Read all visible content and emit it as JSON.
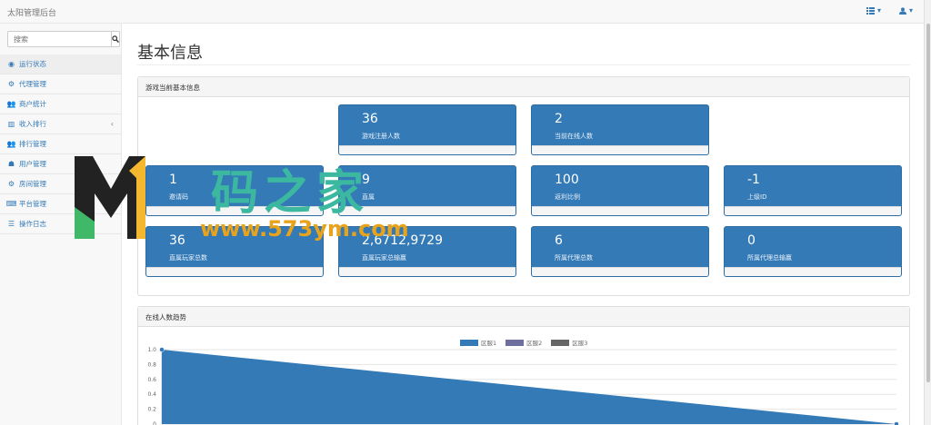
{
  "navbar": {
    "brand": "太阳管理后台",
    "menu_icon_caret": "▾",
    "user_icon_caret": "▾"
  },
  "sidebar": {
    "search_placeholder": "搜索",
    "items": [
      {
        "label": "运行状态",
        "icon": "dashboard-icon",
        "glyph": "◉",
        "active": true
      },
      {
        "label": "代理管理",
        "icon": "gear-icon",
        "glyph": "⚙"
      },
      {
        "label": "商户统计",
        "icon": "users-icon",
        "glyph": "👥"
      },
      {
        "label": "收入排行",
        "icon": "bar-chart-icon",
        "glyph": "▥",
        "caret": "‹"
      },
      {
        "label": "排行管理",
        "icon": "users-icon",
        "glyph": "👥"
      },
      {
        "label": "用户管理",
        "icon": "user-icon",
        "glyph": "☗"
      },
      {
        "label": "房间管理",
        "icon": "gear-icon",
        "glyph": "⚙"
      },
      {
        "label": "平台管理",
        "icon": "keyboard-icon",
        "glyph": "⌨"
      },
      {
        "label": "操作日志",
        "icon": "list-icon",
        "glyph": "☰"
      }
    ]
  },
  "main": {
    "page_title": "基本信息",
    "info_panel_title": "游戏当前基本信息",
    "stats": [
      {
        "value": "36",
        "label": "游戏注册人数"
      },
      {
        "value": "2",
        "label": "当前在线人数"
      },
      {
        "value": "1",
        "label": "邀请码"
      },
      {
        "value": "9",
        "label": "直属"
      },
      {
        "value": "100",
        "label": "返利比例"
      },
      {
        "value": "-1",
        "label": "上级ID"
      },
      {
        "value": "36",
        "label": "直属玩家总数"
      },
      {
        "value": "2,6712,9729",
        "label": "直属玩家总输赢"
      },
      {
        "value": "6",
        "label": "所属代理总数"
      },
      {
        "value": "0",
        "label": "所属代理总输赢"
      }
    ],
    "chart_panel_title": "在线人数趋势"
  },
  "watermark": {
    "logo_letter": "M",
    "title": "码之家",
    "url": "www.573ym.com"
  },
  "colors": {
    "primary": "#337ab7",
    "series1": "#337ab7",
    "series2": "#6f6f9f",
    "series3": "#666666"
  },
  "chart_data": {
    "type": "area",
    "series": [
      {
        "name": "区服1",
        "x": [
          0,
          1
        ],
        "values": [
          1.0,
          0.0
        ]
      },
      {
        "name": "区服2",
        "values": []
      },
      {
        "name": "区服3",
        "values": []
      }
    ],
    "yticks": [
      "1.0",
      "0.8",
      "0.6",
      "0.4",
      "0.2",
      "0"
    ],
    "ylim": [
      0,
      1.0
    ],
    "grid": true,
    "legend": "top-center"
  }
}
